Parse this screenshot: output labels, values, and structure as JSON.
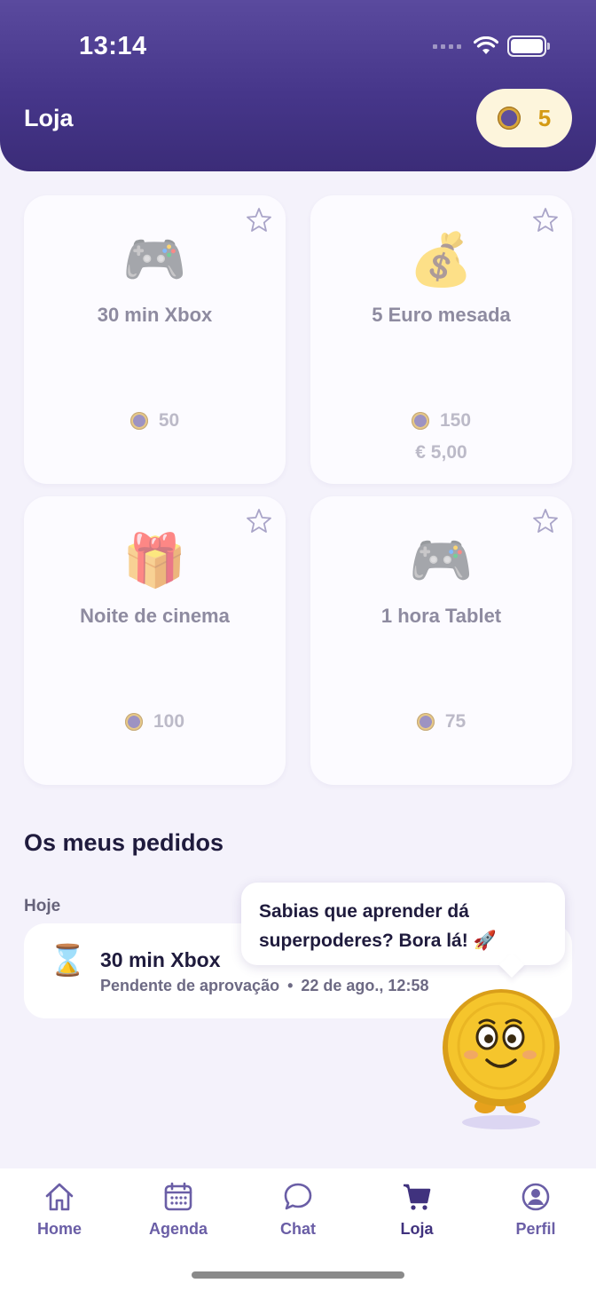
{
  "status_bar": {
    "time": "13:14"
  },
  "header": {
    "title": "Loja",
    "coin_count": "5"
  },
  "shop": {
    "items": [
      {
        "emoji": "🎮",
        "title": "30 min Xbox",
        "price": "50",
        "euro": ""
      },
      {
        "emoji": "💰",
        "title": "5 Euro mesada",
        "price": "150",
        "euro": "€ 5,00"
      },
      {
        "emoji": "🎁",
        "title": "Noite de cinema",
        "price": "100",
        "euro": ""
      },
      {
        "emoji": "🎮",
        "title": "1 hora Tablet",
        "price": "75",
        "euro": ""
      }
    ]
  },
  "orders": {
    "section_title": "Os meus pedidos",
    "day_label": "Hoje",
    "items": [
      {
        "icon": "⌛",
        "title": "30 min Xbox",
        "status": "Pendente de aprovação",
        "separator": "•",
        "date": "22 de ago., 12:58"
      }
    ]
  },
  "mascot": {
    "bubble_line1": "Sabias que aprender dá",
    "bubble_line2": "superpoderes? Bora lá! 🚀"
  },
  "tabbar": {
    "tabs": [
      {
        "label": "Home",
        "icon": "home-icon"
      },
      {
        "label": "Agenda",
        "icon": "calendar-icon"
      },
      {
        "label": "Chat",
        "icon": "chat-icon"
      },
      {
        "label": "Loja",
        "icon": "cart-icon",
        "active": true
      },
      {
        "label": "Perfil",
        "icon": "profile-icon"
      }
    ]
  },
  "colors": {
    "header": "#46368a",
    "accent_gold": "#d49a14",
    "tab_icon": "#6a5ea6",
    "background": "#f4f2fb"
  }
}
